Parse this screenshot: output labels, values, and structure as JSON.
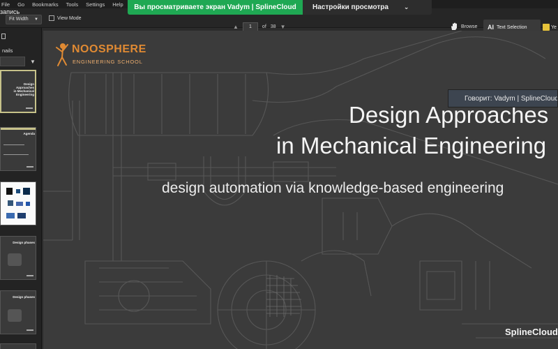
{
  "menu": [
    "File",
    "Go",
    "Bookmarks",
    "Tools",
    "Settings",
    "Help"
  ],
  "toolbar": {
    "fit_value": "Fit Width",
    "view_mode_label": "View Mode",
    "page_current": "1",
    "page_of": "of",
    "page_total": "38",
    "browse_label": "Browse",
    "text_selection_label": "Text Selection",
    "yellow_tool_label": "Ye"
  },
  "banner": {
    "viewing_text": "Вы просматриваете экран Vadym | SplineCloud",
    "settings_text": "Настройки просмотра"
  },
  "sidebar": {
    "top_label": "запись",
    "title": "nails",
    "thumbs": [
      {
        "title_line1": "Design Approaches",
        "title_line2": "in Mechanical Engineering"
      },
      {
        "title_line1": "Agenda",
        "title_line2": ""
      },
      {
        "title_line1": "",
        "title_line2": ""
      },
      {
        "title_line1": "Design phases",
        "title_line2": ""
      },
      {
        "title_line1": "Design phases",
        "title_line2": ""
      }
    ]
  },
  "slide": {
    "logo_brand": "NOOSPHERE",
    "logo_sub": "ENGINEERING SCHOOL",
    "title_line1": "Design Approaches",
    "title_line2": "in Mechanical Engineering",
    "subtitle": "design automation via knowledge-based engineering",
    "footer_brand": "SplineCloud"
  },
  "speaking": {
    "text": "Говорит: Vadym | SplineCloud"
  },
  "colors": {
    "banner_green": "#1fa853",
    "logo_orange": "#e08a33",
    "slide_bg": "#3b3b3b",
    "highlight_yellow": "#e6c23a"
  }
}
